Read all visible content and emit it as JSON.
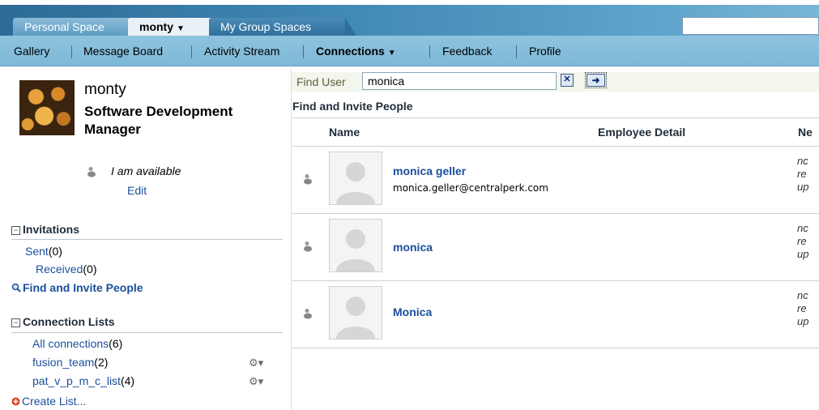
{
  "tabs": {
    "personal": "Personal Space",
    "monty": "monty",
    "groups": "My Group Spaces"
  },
  "nav": {
    "gallery": "Gallery",
    "message_board": "Message Board",
    "activity_stream": "Activity Stream",
    "connections": "Connections",
    "feedback": "Feedback",
    "profile": "Profile"
  },
  "profile": {
    "name": "monty",
    "title": "Software Development Manager",
    "status": "I am available",
    "edit": "Edit"
  },
  "invitations": {
    "heading": "Invitations",
    "collapse_glyph": "−",
    "sent_label": "Sent",
    "sent_count": "(0)",
    "received_label": "Received",
    "received_count": "(0)",
    "find_invite": "Find and Invite People"
  },
  "connection_lists": {
    "heading": "Connection Lists",
    "collapse_glyph": "−",
    "all_label": "All connections",
    "all_count": "(6)",
    "list1_label": "fusion_team",
    "list1_count": "(2)",
    "list2_label": "pat_v_p_m_c_list",
    "list2_count": "(4)",
    "create": "Create List..."
  },
  "find_user": {
    "label": "Find User",
    "value": "monica"
  },
  "results": {
    "title": "Find and Invite People",
    "col_name": "Name",
    "col_detail": "Employee Detail",
    "col_note": "Ne",
    "rows": [
      {
        "name": "monica geller",
        "email": "monica.geller@centralperk.com",
        "note1": "nc",
        "note2": "re",
        "note3": "up"
      },
      {
        "name": "monica",
        "email": "",
        "note1": "nc",
        "note2": "re",
        "note3": "up"
      },
      {
        "name": "Monica",
        "email": "",
        "note1": "nc",
        "note2": "re",
        "note3": "up"
      }
    ]
  },
  "icons": {
    "presence": "presence-available-icon",
    "gear": "gear-icon",
    "search": "magnifier-icon",
    "clear": "clear-icon",
    "go": "go-arrow-icon",
    "create": "create-list-icon"
  },
  "colors": {
    "link": "#1a4f9c",
    "nav_bg": "#8ec3de",
    "tab_active": "#eaf1f6"
  }
}
